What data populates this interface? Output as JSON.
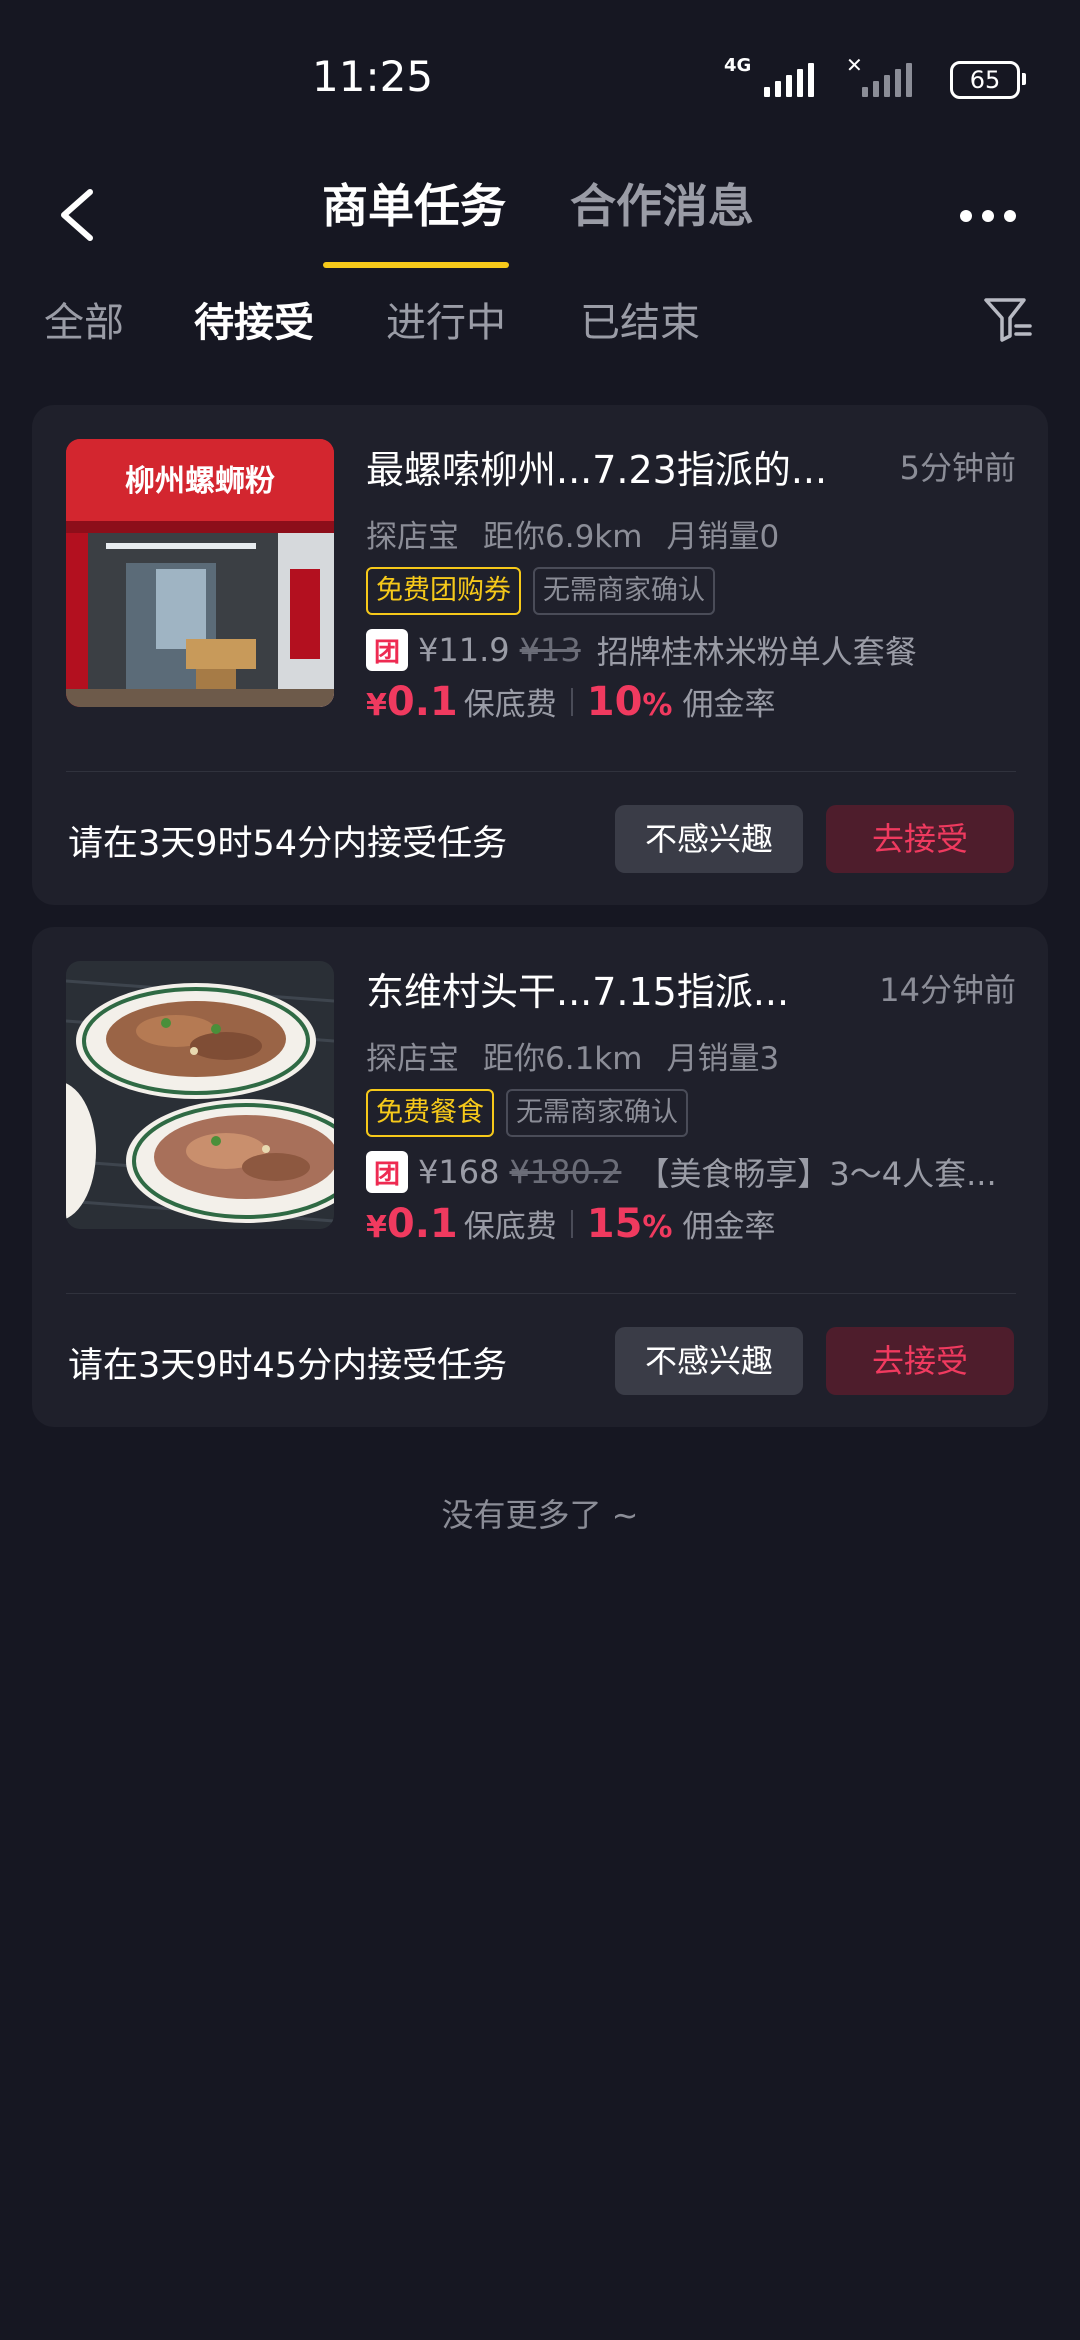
{
  "status_bar": {
    "time": "11:25",
    "network": "4G",
    "battery": "65"
  },
  "header": {
    "tabs": [
      {
        "label": "商单任务",
        "active": true
      },
      {
        "label": "合作消息",
        "active": false
      }
    ],
    "accent_color": "#f6c91a"
  },
  "sub_tabs": [
    {
      "label": "全部",
      "active": false
    },
    {
      "label": "待接受",
      "active": true
    },
    {
      "label": "进行中",
      "active": false
    },
    {
      "label": "已结束",
      "active": false
    }
  ],
  "tasks": [
    {
      "title": "最螺嗦柳州...7.23指派的...",
      "time_ago": "5分钟前",
      "source": "探店宝",
      "distance": "距你6.9km",
      "monthly_sales": "月销量0",
      "tags": [
        "免费团购券",
        "无需商家确认"
      ],
      "deal_badge": "团",
      "price": "¥11.9",
      "original_price": "¥13",
      "deal_name": "招牌桂林米粉单人套餐",
      "fee_currency": "¥",
      "fee_amount": "0.1",
      "fee_label": "保底费",
      "rate_value": "10",
      "rate_unit": "%",
      "rate_label": "佣金率",
      "deadline": "请在3天9时54分内接受任务",
      "ignore_label": "不感兴趣",
      "accept_label": "去接受",
      "sign_text": "柳州螺蛳粉"
    },
    {
      "title": "东维村头干...7.15指派...",
      "time_ago": "14分钟前",
      "source": "探店宝",
      "distance": "距你6.1km",
      "monthly_sales": "月销量3",
      "tags": [
        "免费餐食",
        "无需商家确认"
      ],
      "deal_badge": "团",
      "price": "¥168",
      "original_price": "¥180.2",
      "deal_name": "【美食畅享】3～4人套...",
      "fee_currency": "¥",
      "fee_amount": "0.1",
      "fee_label": "保底费",
      "rate_value": "15",
      "rate_unit": "%",
      "rate_label": "佣金率",
      "deadline": "请在3天9时45分内接受任务",
      "ignore_label": "不感兴趣",
      "accept_label": "去接受"
    }
  ],
  "footer_text": "没有更多了 ~",
  "colors": {
    "background": "#161722",
    "card": "#1f202b",
    "accent_red": "#f03a5f",
    "accent_yellow": "#f6c91a"
  }
}
